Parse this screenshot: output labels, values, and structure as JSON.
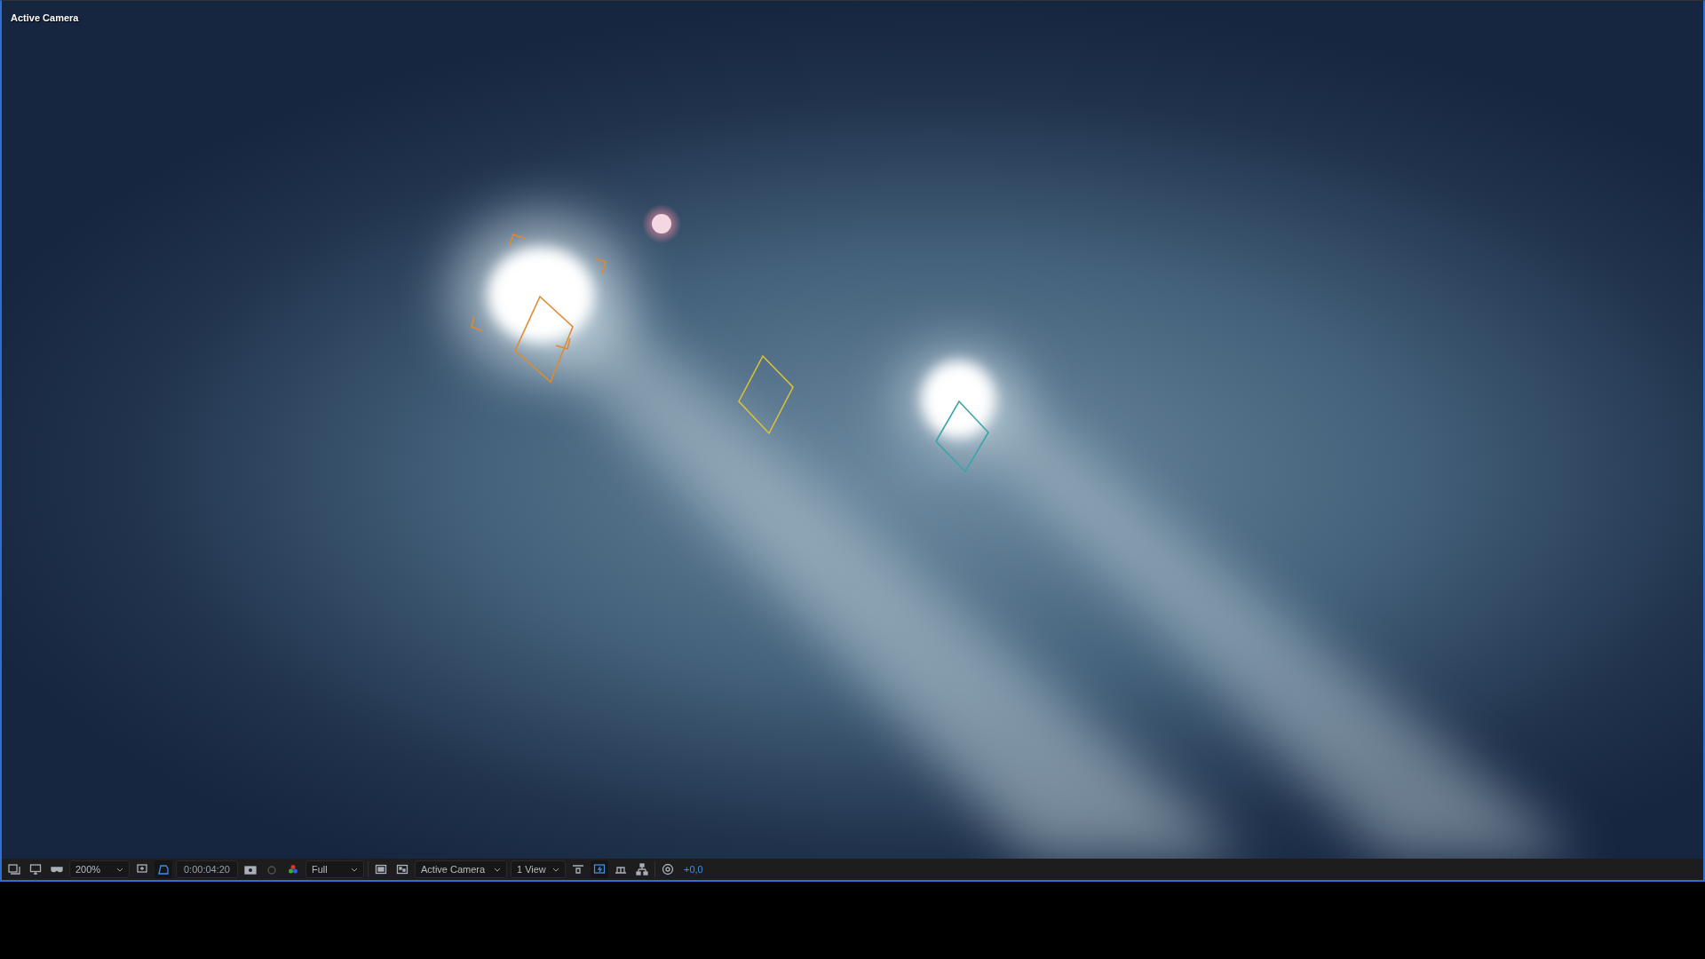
{
  "viewer": {
    "label": "Active Camera"
  },
  "toolbar": {
    "zoom": "200%",
    "timecode": "0:00:04:20",
    "resolution": "Full",
    "view": "Active Camera",
    "layout": "1 View",
    "exposure": "+0,0",
    "mask_path_on": true,
    "fast_previews_on": true
  }
}
